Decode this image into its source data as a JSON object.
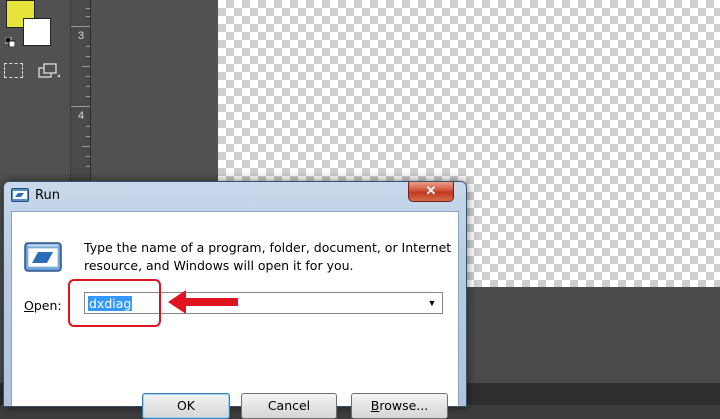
{
  "photoshop": {
    "ruler_labels": [
      "3",
      "4"
    ],
    "colors": {
      "foreground": "#e6e33a",
      "background": "#ffffff"
    }
  },
  "dialog": {
    "title": "Run",
    "close_glyph": "✕",
    "message": "Type the name of a program, folder, document, or Internet resource, and Windows will open it for you.",
    "open_label_prefix": "",
    "open_label_accel": "O",
    "open_label_rest": "pen:",
    "open_value": "dxdiag",
    "buttons": {
      "ok": "OK",
      "cancel": "Cancel",
      "browse_accel": "B",
      "browse_rest": "rowse..."
    }
  },
  "annotation": {
    "color": "#e0141e"
  },
  "icons": [
    "run-icon",
    "close-icon",
    "chevron-down-icon",
    "marquee-icon",
    "screen-mode-icon",
    "default-colors-icon"
  ]
}
